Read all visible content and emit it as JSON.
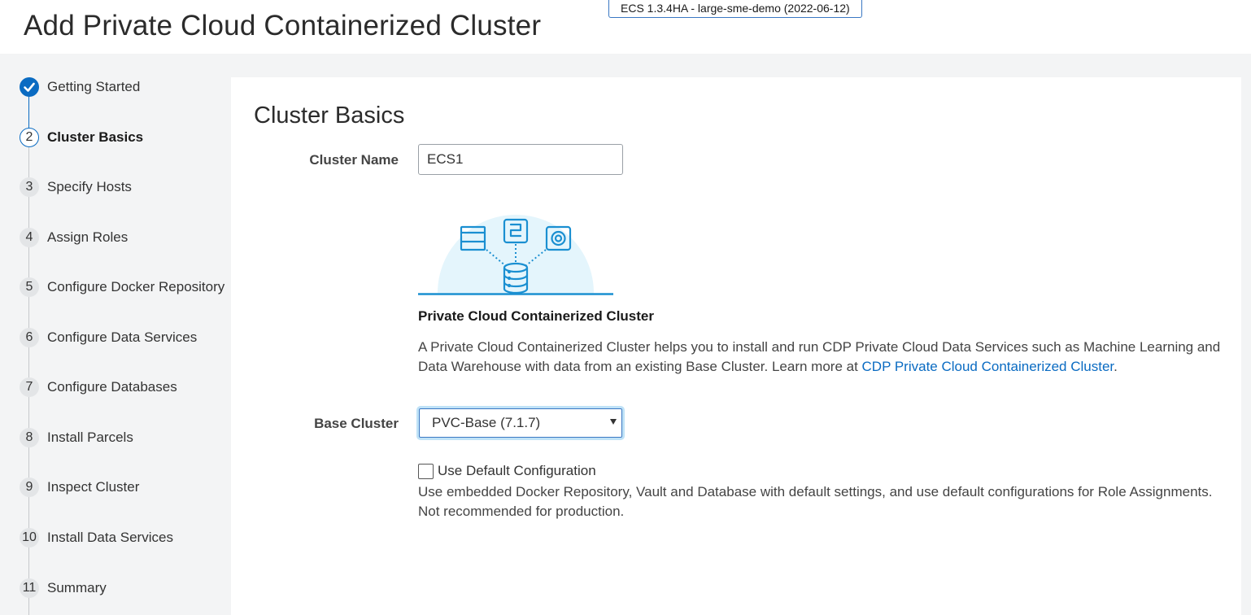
{
  "header": {
    "title": "Add Private Cloud Containerized Cluster",
    "version_badge": "ECS 1.3.4HA - large-sme-demo (2022-06-12)"
  },
  "steps": [
    {
      "number": "",
      "label": "Getting Started",
      "state": "done"
    },
    {
      "number": "2",
      "label": "Cluster Basics",
      "state": "current"
    },
    {
      "number": "3",
      "label": "Specify Hosts",
      "state": "pending"
    },
    {
      "number": "4",
      "label": "Assign Roles",
      "state": "pending"
    },
    {
      "number": "5",
      "label": "Configure Docker Repository",
      "state": "pending"
    },
    {
      "number": "6",
      "label": "Configure Data Services",
      "state": "pending"
    },
    {
      "number": "7",
      "label": "Configure Databases",
      "state": "pending"
    },
    {
      "number": "8",
      "label": "Install Parcels",
      "state": "pending"
    },
    {
      "number": "9",
      "label": "Inspect Cluster",
      "state": "pending"
    },
    {
      "number": "10",
      "label": "Install Data Services",
      "state": "pending"
    },
    {
      "number": "11",
      "label": "Summary",
      "state": "pending"
    }
  ],
  "main": {
    "section_title": "Cluster Basics",
    "cluster_name": {
      "label": "Cluster Name",
      "value": "ECS1"
    },
    "card": {
      "title": "Private Cloud Containerized Cluster",
      "description": "A Private Cloud Containerized Cluster helps you to install and run CDP Private Cloud Data Services such as Machine Learning and Data Warehouse with data from an existing Base Cluster. Learn more at ",
      "link_text": "CDP Private Cloud Containerized Cluster",
      "description_end": "."
    },
    "base_cluster": {
      "label": "Base Cluster",
      "selected": "PVC-Base (7.1.7)"
    },
    "default_config": {
      "label": "Use Default Configuration",
      "checked": false,
      "description": "Use embedded Docker Repository, Vault and Database with default settings, and use default configurations for Role Assignments. Not recommended for production."
    }
  },
  "colors": {
    "accent": "#0a6bc2",
    "illustration_bg": "#e4f5fc",
    "illustration_line": "#1a8fd1"
  },
  "icons": [
    "check-icon",
    "browser-window-icon",
    "pipeline-icon",
    "target-icon",
    "database-icon",
    "chevron-down-icon"
  ]
}
